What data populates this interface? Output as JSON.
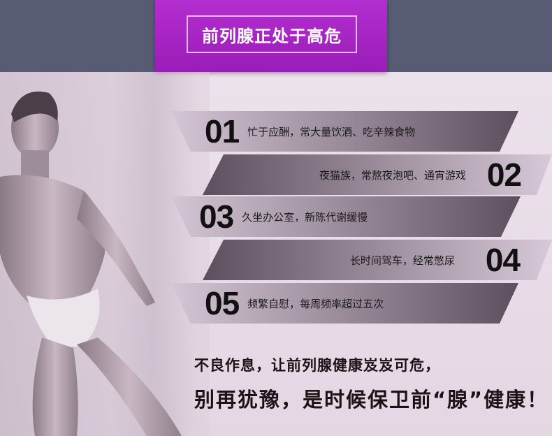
{
  "header": {
    "title": "前列腺正处于高危"
  },
  "items": [
    {
      "number": "01",
      "text": "忙于应酬，常大量饮酒、吃辛辣食物"
    },
    {
      "number": "02",
      "text": "夜猫族，常熬夜泡吧、通宵游戏"
    },
    {
      "number": "03",
      "text": "久坐办公室，新陈代谢缓慢"
    },
    {
      "number": "04",
      "text": "长时间驾车，经常憋尿"
    },
    {
      "number": "05",
      "text": "频繁自慰，每周频率超过五次"
    }
  ],
  "footer": {
    "line1": "不良作息，让前列腺健康岌岌可危，",
    "line2": "别再犹豫，是时候保卫前“腺”健康！"
  },
  "colors": {
    "top_band": "#575c74",
    "title_box": "#a324c2",
    "panel": "#e8dde8",
    "band_dark": "#5d4f5d",
    "band_light": "#d8c9d8"
  }
}
